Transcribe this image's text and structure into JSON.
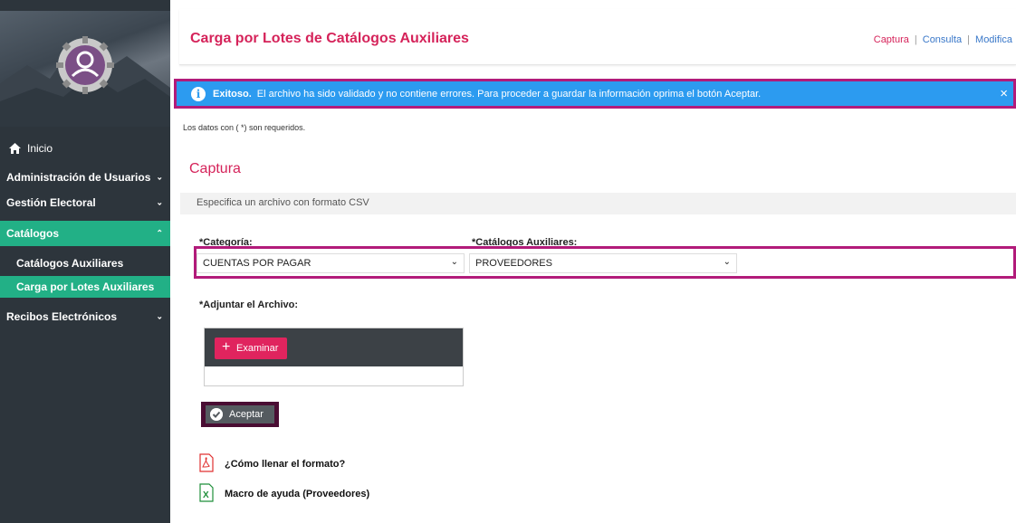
{
  "sidebar": {
    "items": [
      {
        "label": "Inicio"
      },
      {
        "label": "Administración de Usuarios"
      },
      {
        "label": "Gestión Electoral"
      },
      {
        "label": "Catálogos"
      },
      {
        "label": "Catálogos Auxiliares"
      },
      {
        "label": "Carga por Lotes Auxiliares"
      },
      {
        "label": "Recibos Electrónicos"
      }
    ],
    "active_color": "#22b086"
  },
  "header": {
    "title": "Carga por Lotes de Catálogos Auxiliares",
    "links": [
      "Captura",
      "Consulta",
      "Modifica"
    ]
  },
  "alert": {
    "strong": "Exitoso.",
    "message": "El archivo ha sido validado y no contiene errores. Para proceder a guardar la información oprima el botón Aceptar.",
    "close": "×"
  },
  "required_note": "Los datos con ( *) son requeridos.",
  "section_title": "Captura",
  "subheader": "Especifica un archivo con formato CSV",
  "form": {
    "categoria_label": "*Categoría:",
    "categoria_value": "CUENTAS POR PAGAR",
    "catalogos_label": "*Catálogos Auxiliares:",
    "catalogos_value": "PROVEEDORES",
    "file_label": "*Adjuntar el Archivo:",
    "examinar": "Examinar",
    "aceptar": "Aceptar"
  },
  "docs": [
    {
      "label": "¿Cómo llenar el formato?",
      "icon": "pdf-icon"
    },
    {
      "label": "Macro de ayuda (Proveedores)",
      "icon": "excel-icon"
    }
  ],
  "colors": {
    "accent": "#d5235a",
    "alert": "#2c9bf0",
    "highlight": "#b21b7a"
  }
}
